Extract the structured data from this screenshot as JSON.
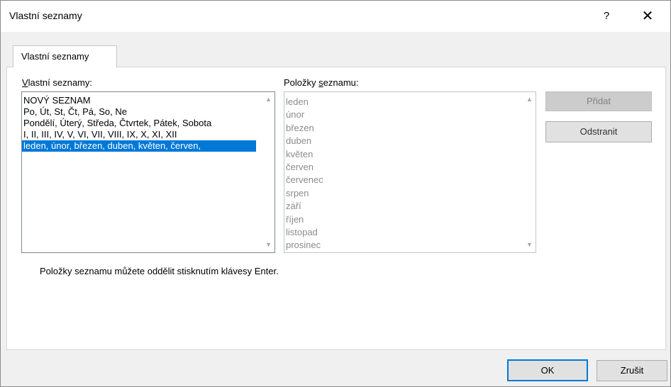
{
  "window": {
    "title": "Vlastní seznamy",
    "help_label": "?",
    "close_label": "✕"
  },
  "tab": {
    "label": "Vlastní seznamy"
  },
  "lists_panel": {
    "label_underlined": "V",
    "label_rest": "lastní seznamy:",
    "items": [
      "NOVÝ SEZNAM",
      "Po, Út, St, Čt, Pá, So, Ne",
      "Pondělí, Úterý, Středa, Čtvrtek, Pátek, Sobota",
      "I, II, III, IV, V, VI, VII, VIII, IX, X, XI, XII",
      "leden, únor, březen, duben, květen, červen,"
    ],
    "selected_index": 4
  },
  "entries_panel": {
    "label_prefix": "Položky ",
    "label_underlined": "s",
    "label_rest": "eznamu:",
    "items": [
      "leden",
      "únor",
      "březen",
      "duben",
      "květen",
      "červen",
      "červenec",
      "srpen",
      "září",
      "říjen",
      "listopad",
      "prosinec"
    ]
  },
  "buttons": {
    "add": "Přidat",
    "remove": "Odstranit",
    "ok": "OK",
    "cancel": "Zrušit"
  },
  "hint": "Položky seznamu můžete oddělit stisknutím klávesy Enter.",
  "icons": {
    "scroll_up": "▲",
    "scroll_down": "▼"
  }
}
